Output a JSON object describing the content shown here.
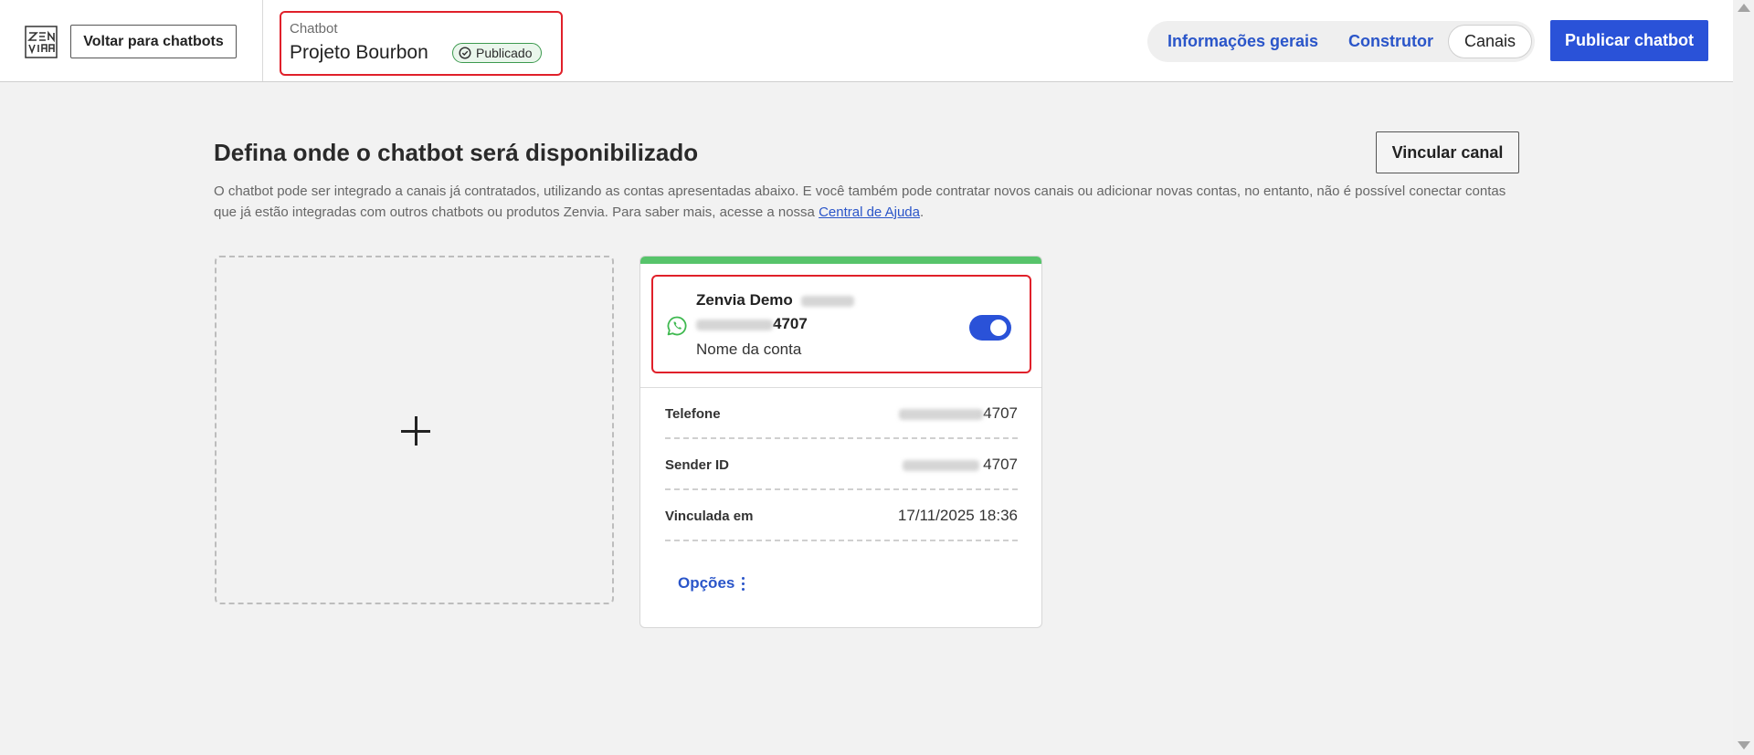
{
  "header": {
    "logo_text": "ZENVIA",
    "back_button": "Voltar para chatbots",
    "chatbot_caption": "Chatbot",
    "chatbot_name": "Projeto Bourbon",
    "status_badge": "Publicado",
    "tabs": [
      {
        "label": "Informações gerais"
      },
      {
        "label": "Construtor"
      },
      {
        "label": "Canais",
        "active": true
      }
    ],
    "publish_button": "Publicar chatbot"
  },
  "main": {
    "title": "Defina onde o chatbot será disponibilizado",
    "link_channel_button": "Vincular canal",
    "description": "O chatbot pode ser integrado a canais já contratados, utilizando as contas apresentadas abaixo. E você também pode contratar novos canais ou adicionar novas contas, no entanto, não é possível conectar contas que já estão integradas com outros chatbots ou produtos Zenvia. Para saber mais, acesse a nossa",
    "help_link": "Central de Ajuda",
    "description_end": "."
  },
  "channel_card": {
    "icon": "whatsapp-icon",
    "account_name": "Zenvia Demo",
    "account_number_suffix": "4707",
    "account_caption": "Nome da conta",
    "toggle_on": true,
    "details": [
      {
        "key": "Telefone",
        "value_suffix": "4707"
      },
      {
        "key": "Sender ID",
        "value_suffix": "4707"
      },
      {
        "key": "Vinculada em",
        "value": "17/11/2025 18:36"
      }
    ],
    "options_label": "Opções"
  },
  "colors": {
    "accent": "#2a52d8",
    "link": "#2a55c9",
    "highlight": "#e0202a",
    "whatsapp": "#3fb950",
    "card_top_bar": "#57c46b"
  }
}
